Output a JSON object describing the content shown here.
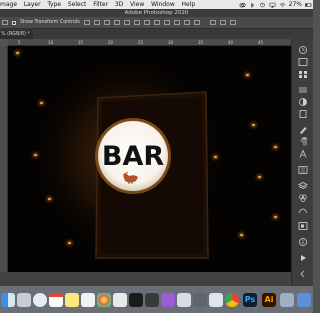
{
  "menubar": {
    "items": [
      "mage",
      "Layer",
      "Type",
      "Select",
      "Filter",
      "3D",
      "View",
      "Window",
      "Help"
    ],
    "battery": "27%"
  },
  "window": {
    "title": "Adobe Photoshop 2020"
  },
  "options": {
    "show_transform_controls": "Show Transform Controls"
  },
  "document": {
    "tab_label": "% (RGB/8) *"
  },
  "ruler": {
    "ticks": [
      "5",
      "10",
      "15",
      "20",
      "25",
      "30",
      "35",
      "40",
      "45"
    ]
  },
  "image": {
    "sign_text": "BAR"
  },
  "dock": {
    "apps": [
      "finder",
      "launchpad",
      "safari",
      "calendar",
      "notes",
      "reminders",
      "photos",
      "messages",
      "music",
      "apple-tv",
      "podcasts",
      "app-store",
      "system-preferences",
      "preview",
      "chrome",
      "photoshop",
      "illustrator",
      "capture",
      "downloads"
    ],
    "ps_label": "Ps",
    "ai_label": "Ai"
  },
  "colors": {
    "accent": "#f1a43a",
    "sign_ring": "#7a4a16",
    "ps_bg": "#0b1e33",
    "ps_fg": "#31a8ff",
    "ai_bg": "#2c1600",
    "ai_fg": "#ff9a00"
  }
}
